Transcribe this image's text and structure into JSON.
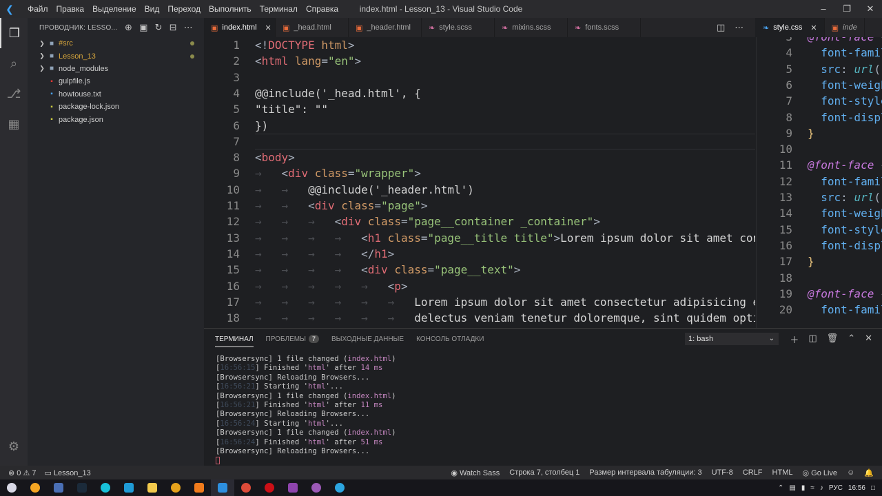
{
  "window": {
    "title": "index.html - Lesson_13 - Visual Studio Code",
    "menu": [
      "Файл",
      "Правка",
      "Выделение",
      "Вид",
      "Переход",
      "Выполнить",
      "Терминал",
      "Справка"
    ]
  },
  "sidebar": {
    "title": "ПРОВОДНИК: LESSO...",
    "items": [
      {
        "label": "#src",
        "type": "folder",
        "color": "#d7a63c"
      },
      {
        "label": "Lesson_13",
        "type": "folder",
        "color": "#d7a63c"
      },
      {
        "label": "node_modules",
        "type": "folder",
        "color": "#cccccc"
      },
      {
        "label": "gulpfile.js",
        "type": "file",
        "color": "#cccccc"
      },
      {
        "label": "howtouse.txt",
        "type": "file",
        "color": "#cccccc"
      },
      {
        "label": "package-lock.json",
        "type": "file",
        "color": "#cccccc"
      },
      {
        "label": "package.json",
        "type": "file",
        "color": "#cccccc"
      }
    ]
  },
  "tabs": [
    {
      "label": "index.html",
      "active": true
    },
    {
      "label": "_head.html",
      "active": false
    },
    {
      "label": "_header.html",
      "active": false
    },
    {
      "label": "style.scss",
      "active": false
    },
    {
      "label": "mixins.scss",
      "active": false
    },
    {
      "label": "fonts.scss",
      "active": false
    }
  ],
  "split_tabs": [
    {
      "label": "style.css"
    },
    {
      "label": "inde"
    }
  ],
  "editor": {
    "lines": [
      {
        "n": "1",
        "html": "<span class='t-punc'>&lt;!</span><span class='t-tag'>DOCTYPE</span> <span class='t-attr'>html</span><span class='t-punc'>&gt;</span>"
      },
      {
        "n": "2",
        "html": "<span class='t-punc'>&lt;</span><span class='t-tag'>html</span> <span class='t-attr'>lang</span><span class='t-punc'>=</span><span class='t-str'>\"en\"</span><span class='t-punc'>&gt;</span>"
      },
      {
        "n": "3",
        "html": ""
      },
      {
        "n": "4",
        "html": "<span class='t-txt'>@@include('_head.html', {</span>"
      },
      {
        "n": "5",
        "html": "<span class='t-txt'>\"title\": \"\"</span>"
      },
      {
        "n": "6",
        "html": "<span class='t-txt'>})</span>"
      },
      {
        "n": "7",
        "html": ""
      },
      {
        "n": "8",
        "html": "<span class='t-punc'>&lt;</span><span class='t-tag'>body</span><span class='t-punc'>&gt;</span>"
      },
      {
        "n": "9",
        "html": "<span class='t-ws'>→   </span><span class='t-punc'>&lt;</span><span class='t-tag'>div</span> <span class='t-attr'>class</span><span class='t-punc'>=</span><span class='t-str'>\"wrapper\"</span><span class='t-punc'>&gt;</span>"
      },
      {
        "n": "10",
        "html": "<span class='t-ws'>→   →   </span><span class='t-txt'>@@include('_header.html')</span>"
      },
      {
        "n": "11",
        "html": "<span class='t-ws'>→   →   </span><span class='t-punc'>&lt;</span><span class='t-tag'>div</span> <span class='t-attr'>class</span><span class='t-punc'>=</span><span class='t-str'>\"page\"</span><span class='t-punc'>&gt;</span>"
      },
      {
        "n": "12",
        "html": "<span class='t-ws'>→   →   →   </span><span class='t-punc'>&lt;</span><span class='t-tag'>div</span> <span class='t-attr'>class</span><span class='t-punc'>=</span><span class='t-str'>\"page__container _container\"</span><span class='t-punc'>&gt;</span>"
      },
      {
        "n": "13",
        "html": "<span class='t-ws'>→   →   →   →   </span><span class='t-punc'>&lt;</span><span class='t-tag'>h1</span> <span class='t-attr'>class</span><span class='t-punc'>=</span><span class='t-str'>\"page__title title\"</span><span class='t-punc'>&gt;</span><span class='t-txt'>Lorem ipsum dolor sit amet consectetur</span>"
      },
      {
        "n": "14",
        "html": "<span class='t-ws'>→   →   →   →   </span><span class='t-punc'>&lt;/</span><span class='t-tag'>h1</span><span class='t-punc'>&gt;</span>"
      },
      {
        "n": "15",
        "html": "<span class='t-ws'>→   →   →   →   </span><span class='t-punc'>&lt;</span><span class='t-tag'>div</span> <span class='t-attr'>class</span><span class='t-punc'>=</span><span class='t-str'>\"page__text\"</span><span class='t-punc'>&gt;</span>"
      },
      {
        "n": "16",
        "html": "<span class='t-ws'>→   →   →   →   →   </span><span class='t-punc'>&lt;</span><span class='t-tag'>p</span><span class='t-punc'>&gt;</span>"
      },
      {
        "n": "17",
        "html": "<span class='t-ws'>→   →   →   →   →   →   </span><span class='t-txt'>Lorem ipsum dolor sit amet consectetur adipisicing elit. Re</span>"
      },
      {
        "n": "18",
        "html": "<span class='t-ws'>→   →   →   →   →   →   </span><span class='t-txt'>delectus veniam tenetur doloremque, sint quidem optio culpa</span>"
      }
    ]
  },
  "split": {
    "lines": [
      {
        "n": "3",
        "html": "<span class='t-at'>@font-face</span> <span class='t-punc'>{</span>"
      },
      {
        "n": "4",
        "html": "<span class='t-ws'>  </span><span class='t-prop'>font-family</span>"
      },
      {
        "n": "5",
        "html": "<span class='t-ws'>  </span><span class='t-prop'>src</span><span class='t-punc'>: </span><span class='t-fn'>url</span><span class='t-punc'>(\"</span>"
      },
      {
        "n": "6",
        "html": "<span class='t-ws'>  </span><span class='t-prop'>font-weight</span>"
      },
      {
        "n": "7",
        "html": "<span class='t-ws'>  </span><span class='t-prop'>font-style</span>"
      },
      {
        "n": "8",
        "html": "<span class='t-ws'>  </span><span class='t-prop'>font-display</span>"
      },
      {
        "n": "9",
        "html": "<span class='t-punc' style='color:#e5c07b'>}</span>"
      },
      {
        "n": "10",
        "html": ""
      },
      {
        "n": "11",
        "html": "<span class='t-at'>@font-face</span> <span class='t-punc'>{</span>"
      },
      {
        "n": "12",
        "html": "<span class='t-ws'>  </span><span class='t-prop'>font-family</span>"
      },
      {
        "n": "13",
        "html": "<span class='t-ws'>  </span><span class='t-prop'>src</span><span class='t-punc'>: </span><span class='t-fn'>url</span><span class='t-punc'>(\"</span>"
      },
      {
        "n": "14",
        "html": "<span class='t-ws'>  </span><span class='t-prop'>font-weight</span>"
      },
      {
        "n": "15",
        "html": "<span class='t-ws'>  </span><span class='t-prop'>font-style</span>"
      },
      {
        "n": "16",
        "html": "<span class='t-ws'>  </span><span class='t-prop'>font-display</span>"
      },
      {
        "n": "17",
        "html": "<span class='t-punc' style='color:#e5c07b'>}</span>"
      },
      {
        "n": "18",
        "html": ""
      },
      {
        "n": "19",
        "html": "<span class='t-at'>@font-face</span> <span class='t-punc'>{</span>"
      },
      {
        "n": "20",
        "html": "<span class='t-ws'>  </span><span class='t-prop'>font-family</span>"
      }
    ]
  },
  "panel": {
    "tabs": [
      "ТЕРМИНАЛ",
      "ПРОБЛЕМЫ",
      "ВЫХОДНЫЕ ДАННЫЕ",
      "КОНСОЛЬ ОТЛАДКИ"
    ],
    "problems_count": "7",
    "terminal_select": "1: bash",
    "terminal_lines": [
      "[Browsersync] 1 file changed (<span class='tm-mag'>index.html</span>)",
      "[<span class='tm-dim'>16:56:15</span>] Finished '<span class='tm-mag'>html</span>' after <span class='tm-mag'>14 ms</span>",
      "[Browsersync] Reloading Browsers...",
      "[<span class='tm-dim'>16:56:21</span>] Starting '<span class='tm-mag'>html</span>'...",
      "[Browsersync] 1 file changed (<span class='tm-mag'>index.html</span>)",
      "[<span class='tm-dim'>16:56:21</span>] Finished '<span class='tm-mag'>html</span>' after <span class='tm-mag'>11 ms</span>",
      "[Browsersync] Reloading Browsers...",
      "[<span class='tm-dim'>16:56:24</span>] Starting '<span class='tm-mag'>html</span>'...",
      "[Browsersync] 1 file changed (<span class='tm-mag'>index.html</span>)",
      "[<span class='tm-dim'>16:56:24</span>] Finished '<span class='tm-mag'>html</span>' after <span class='tm-mag'>51 ms</span>",
      "[Browsersync] Reloading Browsers...",
      "<span class='tm-cursor'></span>"
    ]
  },
  "status": {
    "errors": "⊗ 0 ⚠ 7",
    "folder": "Lesson_13",
    "watch_sass": "Watch Sass",
    "position": "Строка 7, столбец 1",
    "tab_size": "Размер интервала табуляции: 3",
    "encoding": "UTF-8",
    "eol": "CRLF",
    "language": "HTML",
    "go_live": "Go Live"
  },
  "taskbar": {
    "lang": "РУС",
    "time": "16:56"
  }
}
